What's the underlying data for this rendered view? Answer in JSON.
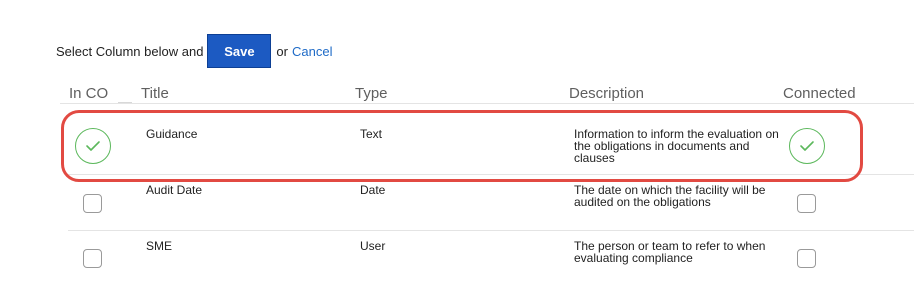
{
  "toolbar": {
    "prompt": "Select Column below and",
    "save_label": "Save",
    "or_label": "or",
    "cancel_label": "Cancel"
  },
  "table": {
    "headers": [
      "In CO",
      "Title",
      "Type",
      "Description",
      "Connected"
    ],
    "rows": [
      {
        "title": "Guidance",
        "type": "Text",
        "description": "Information to inform the evaluation on the obligations in documents and clauses",
        "in_co": true,
        "connected": true
      },
      {
        "title": "Audit Date",
        "type": "Date",
        "description": "The date on which the facility will be audited on the obligations",
        "in_co": false,
        "connected": false
      },
      {
        "title": "SME",
        "type": "User",
        "description": "The person or team to refer to when evaluating compliance",
        "in_co": false,
        "connected": false
      }
    ]
  },
  "colors": {
    "accent": "#1c5ac2",
    "link": "#1f6bc7",
    "check": "#5cb85c",
    "highlight": "#e24a42"
  },
  "icons": {
    "checked": "checkmark-icon"
  }
}
